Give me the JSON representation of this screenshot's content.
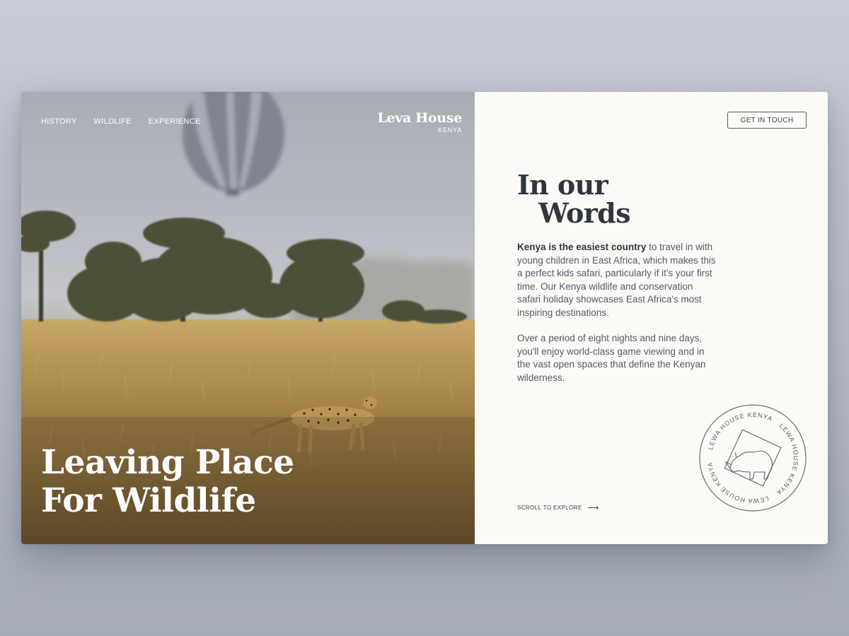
{
  "nav": {
    "items": [
      {
        "label": "HISTORY"
      },
      {
        "label": "WILDLIFE"
      },
      {
        "label": "EXPERIENCE"
      }
    ]
  },
  "logo": {
    "name": "Leva House",
    "subtitle": "KENYA"
  },
  "hero": {
    "line1": "Leaving Place",
    "line2": "For Wildlife"
  },
  "cta": {
    "label": "GET IN TOUCH"
  },
  "section": {
    "heading_line1": "In our",
    "heading_line2": "Words",
    "paragraph1_bold": "Kenya is the easiest country",
    "paragraph1_rest": " to travel in with young children in East Africa, which makes this a perfect kids safari, particularly if it's your first time. Our Kenya wildlife and conservation safari holiday showcases East Africa's most inspiring destinations.",
    "paragraph2": "Over a period of eight nights and nine days, you'll enjoy world-class game viewing and in the vast open spaces that define the Kenyan wilderness."
  },
  "scroll": {
    "label": "SCROLL TO EXPLORE",
    "icon": "arrow-right-icon"
  },
  "stamp": {
    "text": "LEWA HOUSE KENYA",
    "icon": "rhino-icon"
  },
  "colors": {
    "background": "#bcc0cb",
    "panel": "#fbfaf6",
    "heading": "#30353e",
    "body_text": "#555b64",
    "stamp": "#6b7078"
  }
}
